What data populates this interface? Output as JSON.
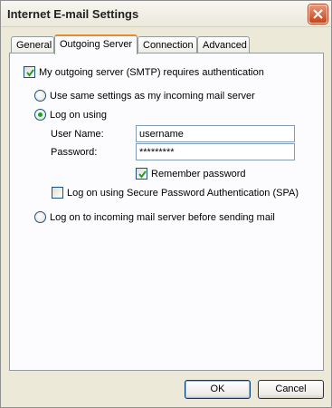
{
  "window": {
    "title": "Internet E-mail Settings"
  },
  "tabs": [
    {
      "label": "General",
      "active": false
    },
    {
      "label": "Outgoing Server",
      "active": true
    },
    {
      "label": "Connection",
      "active": false
    },
    {
      "label": "Advanced",
      "active": false
    }
  ],
  "outgoing": {
    "requires_auth": {
      "label": "My outgoing server (SMTP) requires authentication",
      "checked": true
    },
    "use_same": {
      "label": "Use same settings as my incoming mail server",
      "selected": false
    },
    "log_on_using": {
      "label": "Log on using",
      "selected": true
    },
    "username": {
      "label": "User Name:",
      "value": "username"
    },
    "password": {
      "label": "Password:",
      "value": "*********"
    },
    "remember_password": {
      "label": "Remember password",
      "checked": true
    },
    "spa": {
      "label": "Log on using Secure Password Authentication (SPA)",
      "checked": false
    },
    "log_on_incoming": {
      "label": "Log on to incoming mail server before sending mail",
      "selected": false
    }
  },
  "buttons": {
    "ok": "OK",
    "cancel": "Cancel"
  },
  "colors": {
    "accent_tab": "#e68b2c",
    "check": "#21a121",
    "border": "#919b9c"
  }
}
